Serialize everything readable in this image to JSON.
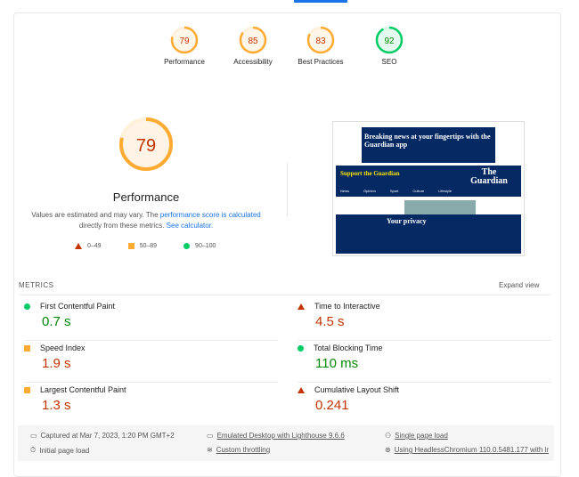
{
  "categories": [
    {
      "label": "Performance",
      "score": 79,
      "color": "#ffaa33",
      "text": "#c33300"
    },
    {
      "label": "Accessibility",
      "score": 85,
      "color": "#ffaa33",
      "text": "#c33300"
    },
    {
      "label": "Best Practices",
      "score": 83,
      "color": "#ffaa33",
      "text": "#c33300"
    },
    {
      "label": "SEO",
      "score": 92,
      "color": "#00cc66",
      "text": "#008800"
    }
  ],
  "perf": {
    "score": 79,
    "title": "Performance",
    "desc_pre": "Values are estimated and may vary. The ",
    "link1": "performance score is calculated",
    "desc_mid": " directly from these metrics. ",
    "link2": "See calculator.",
    "legend": [
      "0–49",
      "50–89",
      "90–100"
    ]
  },
  "screenshot": {
    "banner": "Breaking news at your fingertips with the Guardian app",
    "support": "Support the Guardian",
    "logo": "The Guardian",
    "nav": [
      "News",
      "Opinion",
      "Sport",
      "Culture",
      "Lifestyle"
    ],
    "privacy": "Your privacy"
  },
  "metrics": {
    "header": "METRICS",
    "expand": "Expand view",
    "items": [
      {
        "name": "First Contentful Paint",
        "value": "0.7 s",
        "status": "pass"
      },
      {
        "name": "Time to Interactive",
        "value": "4.5 s",
        "status": "fail"
      },
      {
        "name": "Speed Index",
        "value": "1.9 s",
        "status": "average"
      },
      {
        "name": "Total Blocking Time",
        "value": "110 ms",
        "status": "pass"
      },
      {
        "name": "Largest Contentful Paint",
        "value": "1.3 s",
        "status": "average"
      },
      {
        "name": "Cumulative Layout Shift",
        "value": "0.241",
        "status": "fail"
      }
    ]
  },
  "footer": {
    "captured": "Captured at Mar 7, 2023, 1:20 PM GMT+2",
    "emulated": "Emulated Desktop with Lighthouse 9.6.6",
    "single": "Single page load",
    "initial": "Initial page load",
    "throttling": "Custom throttling",
    "using": "Using HeadlessChromium 110.0.5481.177 with lr"
  }
}
